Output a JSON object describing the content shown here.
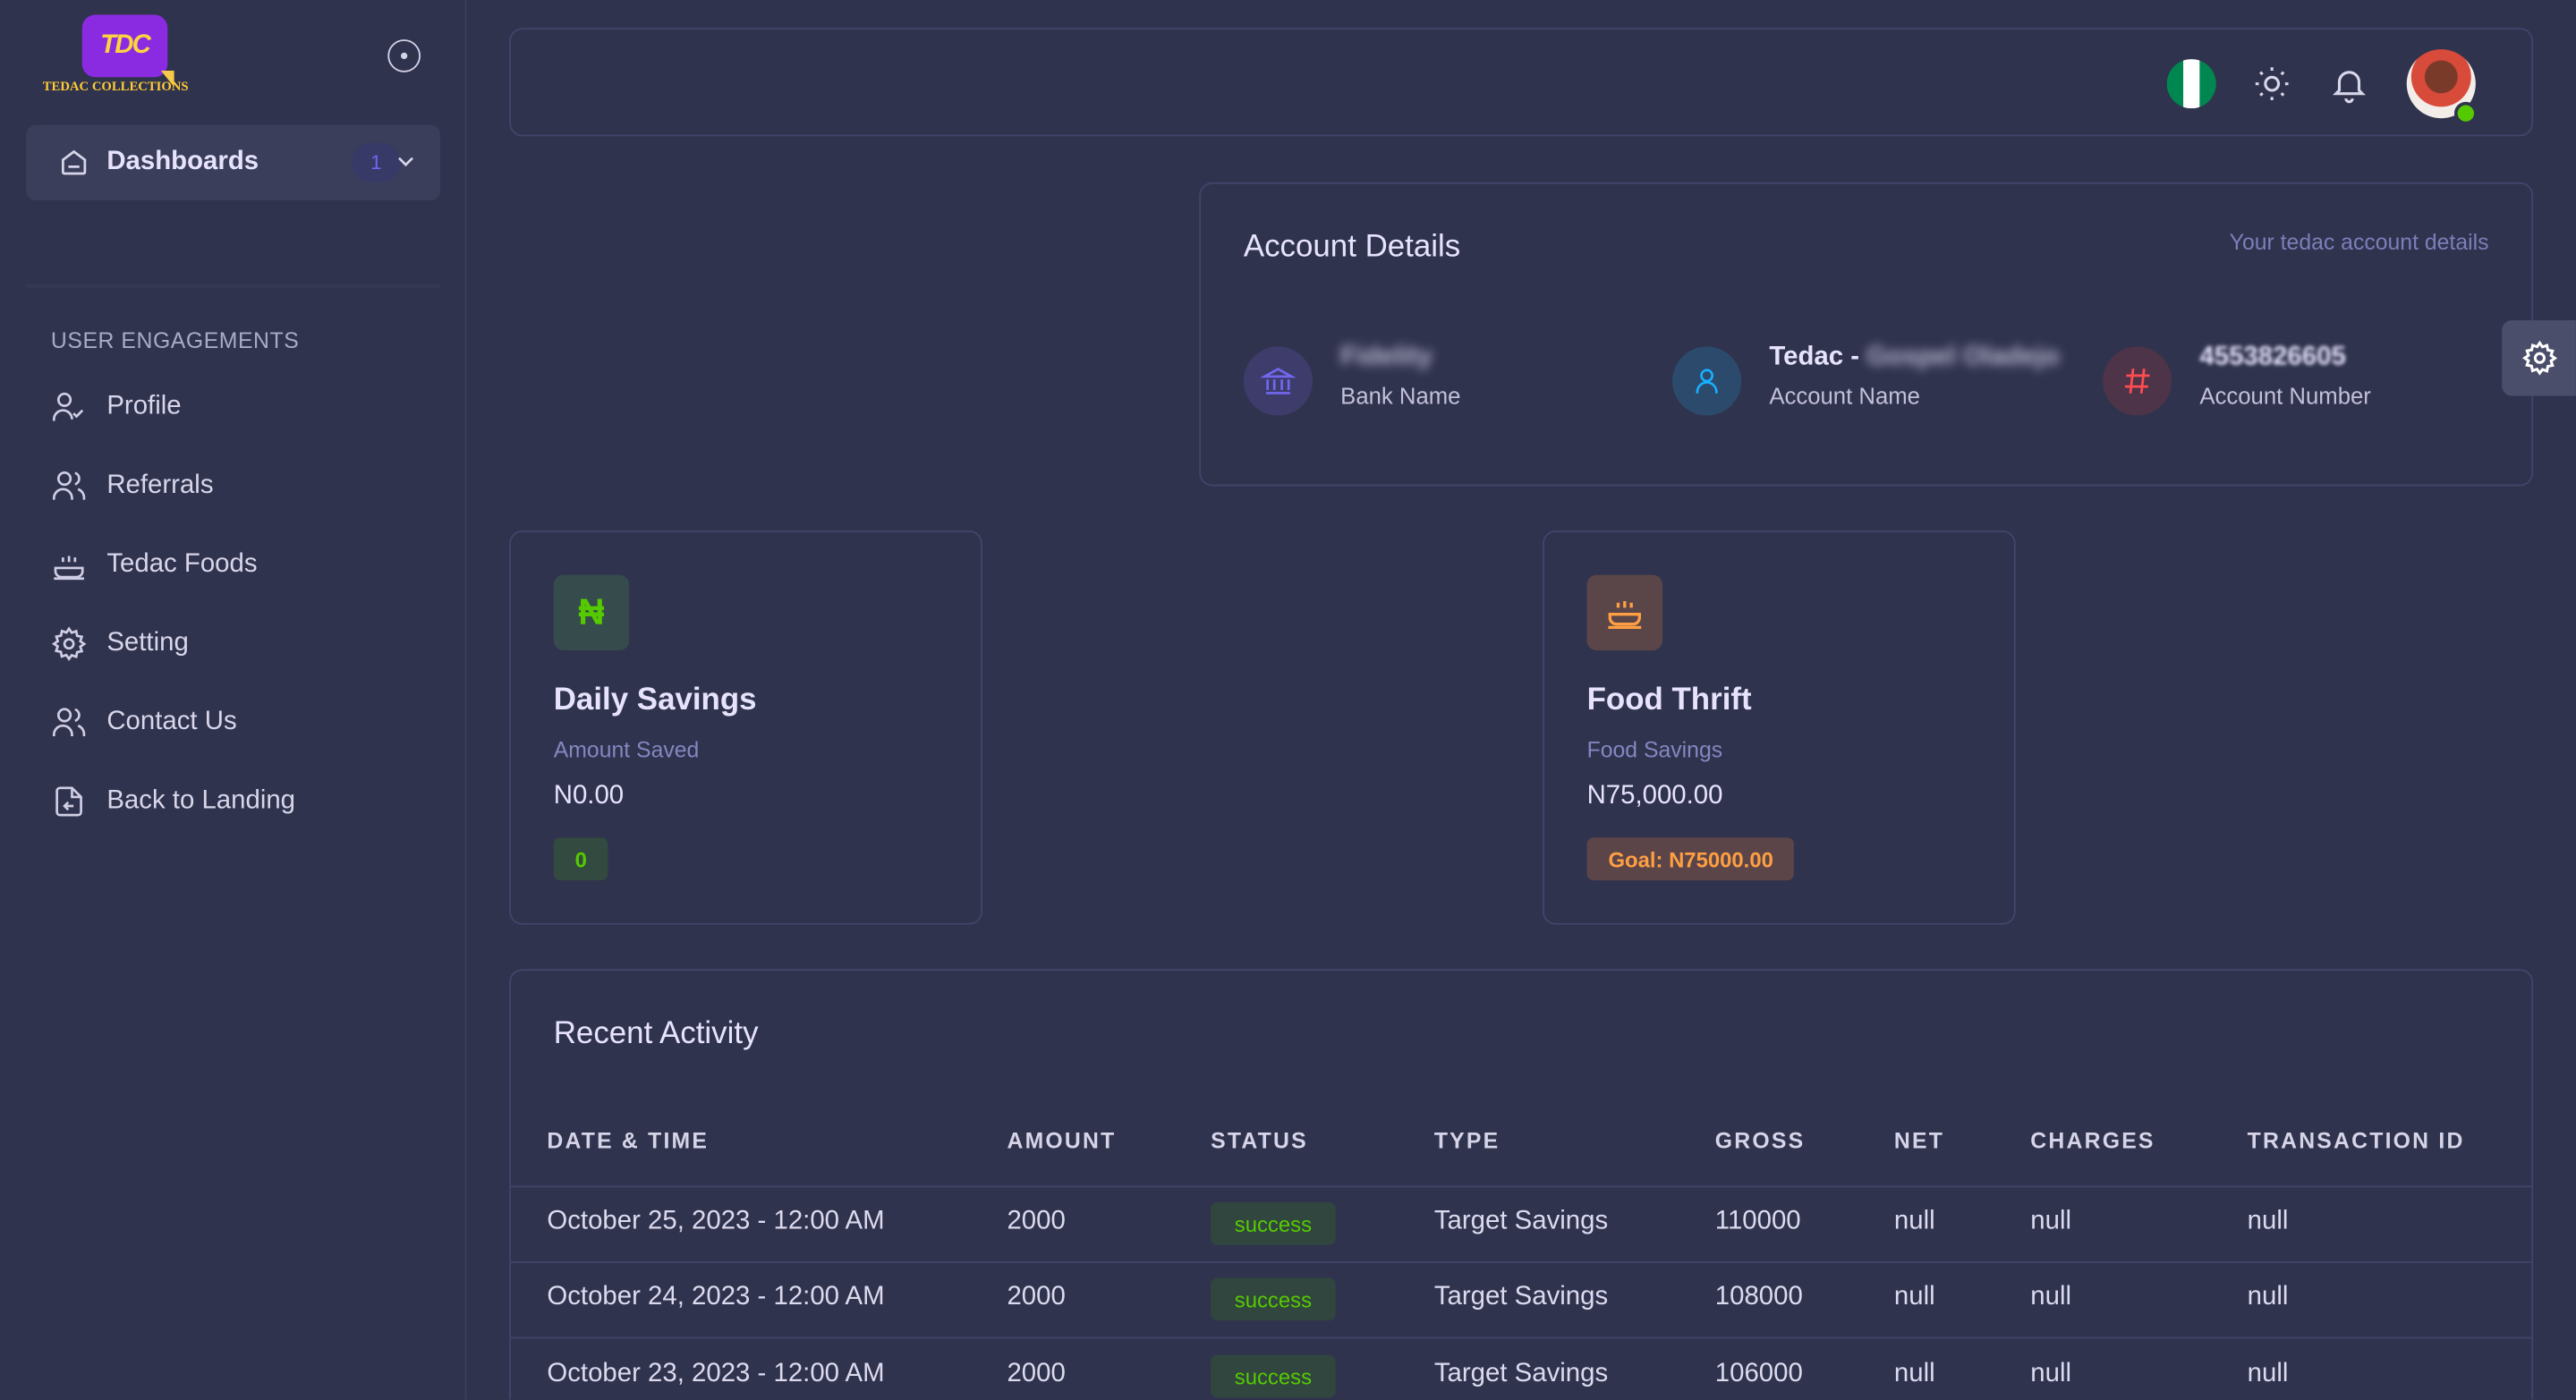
{
  "brand": {
    "logo_text": "TDC",
    "name": "TEDAC COLLECTIONS"
  },
  "sidebar": {
    "dashboards": {
      "label": "Dashboards",
      "badge": "1"
    },
    "section_title": "USER ENGAGEMENTS",
    "items": [
      {
        "label": "Profile",
        "icon": "user-check-icon"
      },
      {
        "label": "Referrals",
        "icon": "users-icon"
      },
      {
        "label": "Tedac Foods",
        "icon": "bowl-icon"
      },
      {
        "label": "Setting",
        "icon": "gear-icon"
      },
      {
        "label": "Contact Us",
        "icon": "users-icon"
      },
      {
        "label": "Back to Landing",
        "icon": "file-arrow-icon"
      }
    ]
  },
  "account": {
    "title": "Account Details",
    "subtitle": "Your tedac account details",
    "bank": {
      "value": "Fidelity",
      "label": "Bank Name"
    },
    "name": {
      "value_prefix": "Tedac -",
      "value_blurred": "Gospel Oladejo",
      "label": "Account Name"
    },
    "number": {
      "value": "4553826605",
      "label": "Account Number"
    }
  },
  "cards": {
    "savings": {
      "title": "Daily Savings",
      "subtitle": "Amount Saved",
      "amount": "N0.00",
      "badge": "0",
      "symbol": "₦"
    },
    "food": {
      "title": "Food Thrift",
      "subtitle": "Food Savings",
      "amount": "N75,000.00",
      "badge": "Goal: N75000.00"
    }
  },
  "activity": {
    "title": "Recent Activity",
    "columns": [
      "DATE & TIME",
      "AMOUNT",
      "STATUS",
      "TYPE",
      "GROSS",
      "NET",
      "CHARGES",
      "TRANSACTION ID"
    ],
    "rows": [
      {
        "date": "October 25, 2023 - 12:00 AM",
        "amount": "2000",
        "status": "success",
        "type": "Target Savings",
        "gross": "110000",
        "net": "null",
        "charges": "null",
        "txid": "null"
      },
      {
        "date": "October 24, 2023 - 12:00 AM",
        "amount": "2000",
        "status": "success",
        "type": "Target Savings",
        "gross": "108000",
        "net": "null",
        "charges": "null",
        "txid": "null"
      },
      {
        "date": "October 23, 2023 - 12:00 AM",
        "amount": "2000",
        "status": "success",
        "type": "Target Savings",
        "gross": "106000",
        "net": "null",
        "charges": "null",
        "txid": "null"
      }
    ]
  },
  "colors": {
    "bg": "#30334e",
    "primary": "#7367f0",
    "success": "#56ca00",
    "warning": "#ff9f43",
    "error": "#ff4c51",
    "info": "#16b1ff"
  }
}
